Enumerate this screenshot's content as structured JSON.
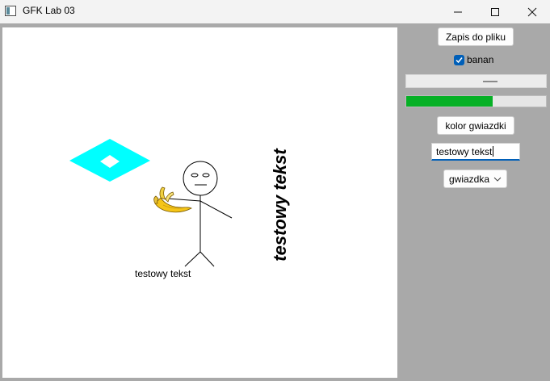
{
  "window": {
    "title": "GFK Lab 03",
    "minimize_glyph": "—",
    "maximize_glyph": "☐",
    "close_glyph": "✕"
  },
  "canvas": {
    "label_text": "testowy tekst",
    "vertical_text": "testowy tekst",
    "star_color": "#00ffff",
    "banana_icon": "banana-icon"
  },
  "panel": {
    "save_button_label": "Zapis do pliku",
    "checkbox_label": "banan",
    "checkbox_checked": true,
    "slider_value_fraction": 0.5,
    "progress_fraction": 0.62,
    "progress_color": "#06b025",
    "color_button_label": "kolor gwiazdki",
    "text_field_value": "testowy tekst",
    "select_value": "gwiazdka"
  }
}
